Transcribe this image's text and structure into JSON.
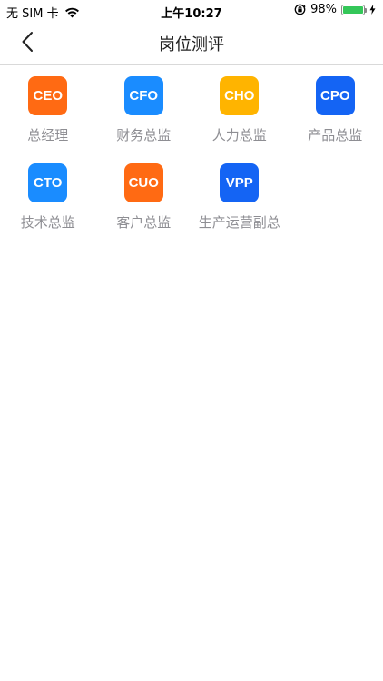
{
  "status_bar": {
    "carrier": "无 SIM 卡",
    "time": "上午10:27",
    "battery_percent": "98%",
    "battery_level": 0.98,
    "battery_color": "#34c759"
  },
  "nav": {
    "title": "岗位测评",
    "back_icon": "chevron-left-icon"
  },
  "tiles": [
    {
      "abbr": "CEO",
      "label": "总经理",
      "color": "#ff6a13"
    },
    {
      "abbr": "CFO",
      "label": "财务总监",
      "color": "#1a8cff"
    },
    {
      "abbr": "CHO",
      "label": "人力总监",
      "color": "#ffb400"
    },
    {
      "abbr": "CPO",
      "label": "产品总监",
      "color": "#1464f4"
    },
    {
      "abbr": "CTO",
      "label": "技术总监",
      "color": "#1a8cff"
    },
    {
      "abbr": "CUO",
      "label": "客户总监",
      "color": "#ff6a13"
    },
    {
      "abbr": "VPP",
      "label": "生产运营副总",
      "color": "#1464f4"
    }
  ]
}
